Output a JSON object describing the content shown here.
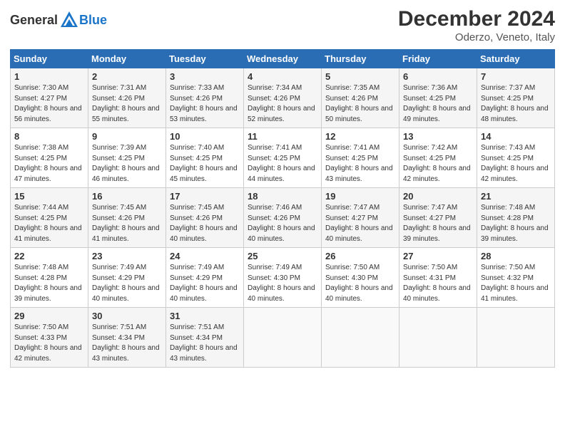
{
  "header": {
    "logo_general": "General",
    "logo_blue": "Blue",
    "title": "December 2024",
    "subtitle": "Oderzo, Veneto, Italy"
  },
  "days_of_week": [
    "Sunday",
    "Monday",
    "Tuesday",
    "Wednesday",
    "Thursday",
    "Friday",
    "Saturday"
  ],
  "weeks": [
    [
      {
        "day": "1",
        "sunrise": "7:30 AM",
        "sunset": "4:27 PM",
        "daylight": "8 hours and 56 minutes."
      },
      {
        "day": "2",
        "sunrise": "7:31 AM",
        "sunset": "4:26 PM",
        "daylight": "8 hours and 55 minutes."
      },
      {
        "day": "3",
        "sunrise": "7:33 AM",
        "sunset": "4:26 PM",
        "daylight": "8 hours and 53 minutes."
      },
      {
        "day": "4",
        "sunrise": "7:34 AM",
        "sunset": "4:26 PM",
        "daylight": "8 hours and 52 minutes."
      },
      {
        "day": "5",
        "sunrise": "7:35 AM",
        "sunset": "4:26 PM",
        "daylight": "8 hours and 50 minutes."
      },
      {
        "day": "6",
        "sunrise": "7:36 AM",
        "sunset": "4:25 PM",
        "daylight": "8 hours and 49 minutes."
      },
      {
        "day": "7",
        "sunrise": "7:37 AM",
        "sunset": "4:25 PM",
        "daylight": "8 hours and 48 minutes."
      }
    ],
    [
      {
        "day": "8",
        "sunrise": "7:38 AM",
        "sunset": "4:25 PM",
        "daylight": "8 hours and 47 minutes."
      },
      {
        "day": "9",
        "sunrise": "7:39 AM",
        "sunset": "4:25 PM",
        "daylight": "8 hours and 46 minutes."
      },
      {
        "day": "10",
        "sunrise": "7:40 AM",
        "sunset": "4:25 PM",
        "daylight": "8 hours and 45 minutes."
      },
      {
        "day": "11",
        "sunrise": "7:41 AM",
        "sunset": "4:25 PM",
        "daylight": "8 hours and 44 minutes."
      },
      {
        "day": "12",
        "sunrise": "7:41 AM",
        "sunset": "4:25 PM",
        "daylight": "8 hours and 43 minutes."
      },
      {
        "day": "13",
        "sunrise": "7:42 AM",
        "sunset": "4:25 PM",
        "daylight": "8 hours and 42 minutes."
      },
      {
        "day": "14",
        "sunrise": "7:43 AM",
        "sunset": "4:25 PM",
        "daylight": "8 hours and 42 minutes."
      }
    ],
    [
      {
        "day": "15",
        "sunrise": "7:44 AM",
        "sunset": "4:25 PM",
        "daylight": "8 hours and 41 minutes."
      },
      {
        "day": "16",
        "sunrise": "7:45 AM",
        "sunset": "4:26 PM",
        "daylight": "8 hours and 41 minutes."
      },
      {
        "day": "17",
        "sunrise": "7:45 AM",
        "sunset": "4:26 PM",
        "daylight": "8 hours and 40 minutes."
      },
      {
        "day": "18",
        "sunrise": "7:46 AM",
        "sunset": "4:26 PM",
        "daylight": "8 hours and 40 minutes."
      },
      {
        "day": "19",
        "sunrise": "7:47 AM",
        "sunset": "4:27 PM",
        "daylight": "8 hours and 40 minutes."
      },
      {
        "day": "20",
        "sunrise": "7:47 AM",
        "sunset": "4:27 PM",
        "daylight": "8 hours and 39 minutes."
      },
      {
        "day": "21",
        "sunrise": "7:48 AM",
        "sunset": "4:28 PM",
        "daylight": "8 hours and 39 minutes."
      }
    ],
    [
      {
        "day": "22",
        "sunrise": "7:48 AM",
        "sunset": "4:28 PM",
        "daylight": "8 hours and 39 minutes."
      },
      {
        "day": "23",
        "sunrise": "7:49 AM",
        "sunset": "4:29 PM",
        "daylight": "8 hours and 40 minutes."
      },
      {
        "day": "24",
        "sunrise": "7:49 AM",
        "sunset": "4:29 PM",
        "daylight": "8 hours and 40 minutes."
      },
      {
        "day": "25",
        "sunrise": "7:49 AM",
        "sunset": "4:30 PM",
        "daylight": "8 hours and 40 minutes."
      },
      {
        "day": "26",
        "sunrise": "7:50 AM",
        "sunset": "4:30 PM",
        "daylight": "8 hours and 40 minutes."
      },
      {
        "day": "27",
        "sunrise": "7:50 AM",
        "sunset": "4:31 PM",
        "daylight": "8 hours and 40 minutes."
      },
      {
        "day": "28",
        "sunrise": "7:50 AM",
        "sunset": "4:32 PM",
        "daylight": "8 hours and 41 minutes."
      }
    ],
    [
      {
        "day": "29",
        "sunrise": "7:50 AM",
        "sunset": "4:33 PM",
        "daylight": "8 hours and 42 minutes."
      },
      {
        "day": "30",
        "sunrise": "7:51 AM",
        "sunset": "4:34 PM",
        "daylight": "8 hours and 43 minutes."
      },
      {
        "day": "31",
        "sunrise": "7:51 AM",
        "sunset": "4:34 PM",
        "daylight": "8 hours and 43 minutes."
      },
      null,
      null,
      null,
      null
    ]
  ],
  "labels": {
    "sunrise": "Sunrise:",
    "sunset": "Sunset:",
    "daylight": "Daylight:"
  }
}
